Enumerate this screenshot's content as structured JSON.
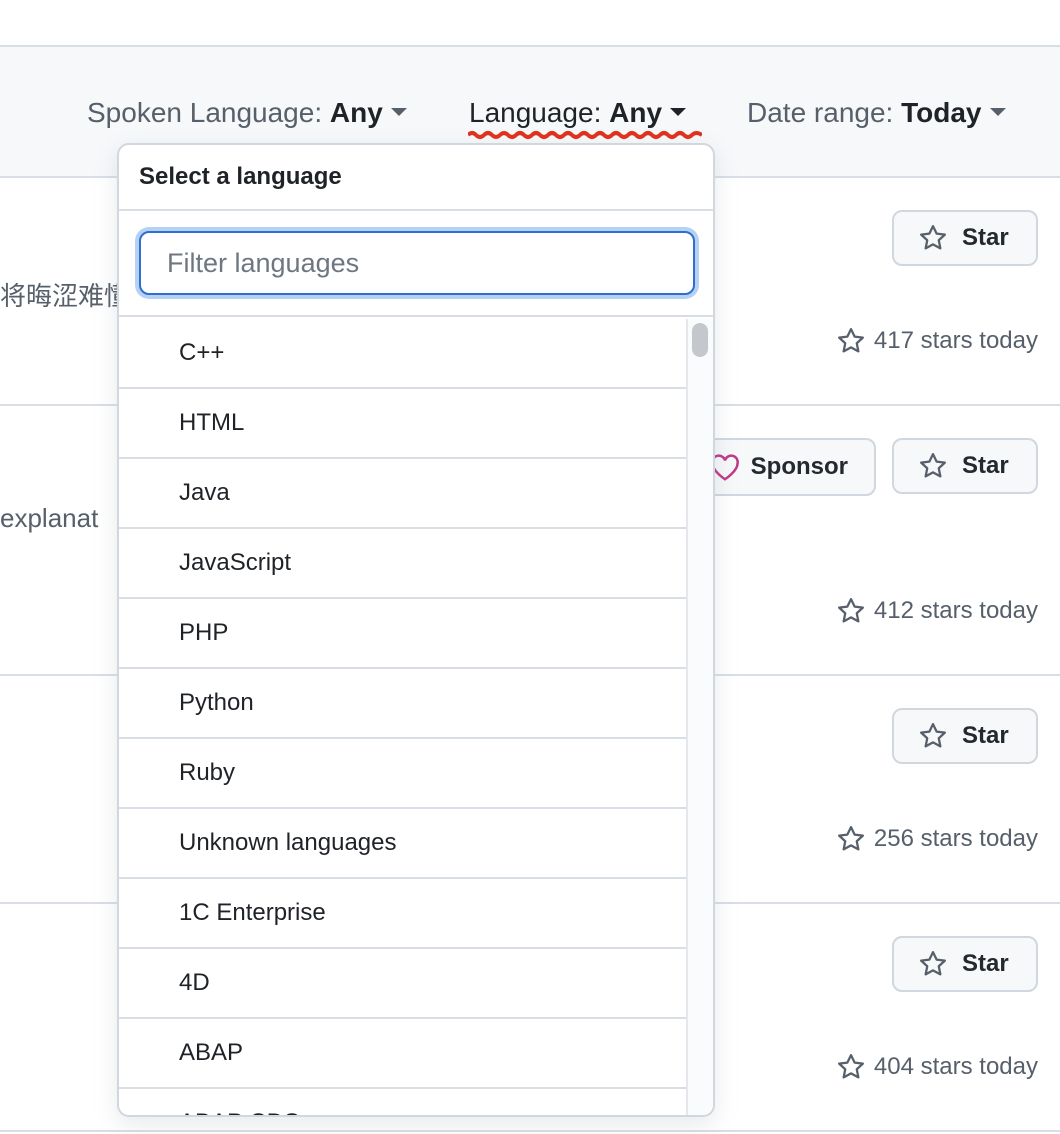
{
  "filters": {
    "spoken_label": "Spoken Language:",
    "spoken_value": "Any",
    "language_label": "Language:",
    "language_value": "Any",
    "date_label": "Date range:",
    "date_value": "Today"
  },
  "dropdown": {
    "title": "Select a language",
    "filter_placeholder": "Filter languages",
    "items": [
      "C++",
      "HTML",
      "Java",
      "JavaScript",
      "PHP",
      "Python",
      "Ruby",
      "Unknown languages",
      "1C Enterprise",
      "4D",
      "ABAP",
      "ABAP CDS"
    ]
  },
  "repos": [
    {
      "desc_fragment": "将晦涩难懂",
      "star_label": "Star",
      "stars_today": "417 stars today"
    },
    {
      "desc_fragment": " explanat",
      "sponsor_label": "Sponsor",
      "star_label": "Star",
      "stars_today": "412 stars today"
    },
    {
      "star_label": "Star",
      "stars_today": "256 stars today"
    },
    {
      "star_label": "Star",
      "stars_today": "404 stars today"
    }
  ],
  "colors": {
    "accent_focus": "#2f6fce",
    "sponsor_heart": "#bf3989",
    "annotation_red": "#e0321c"
  }
}
